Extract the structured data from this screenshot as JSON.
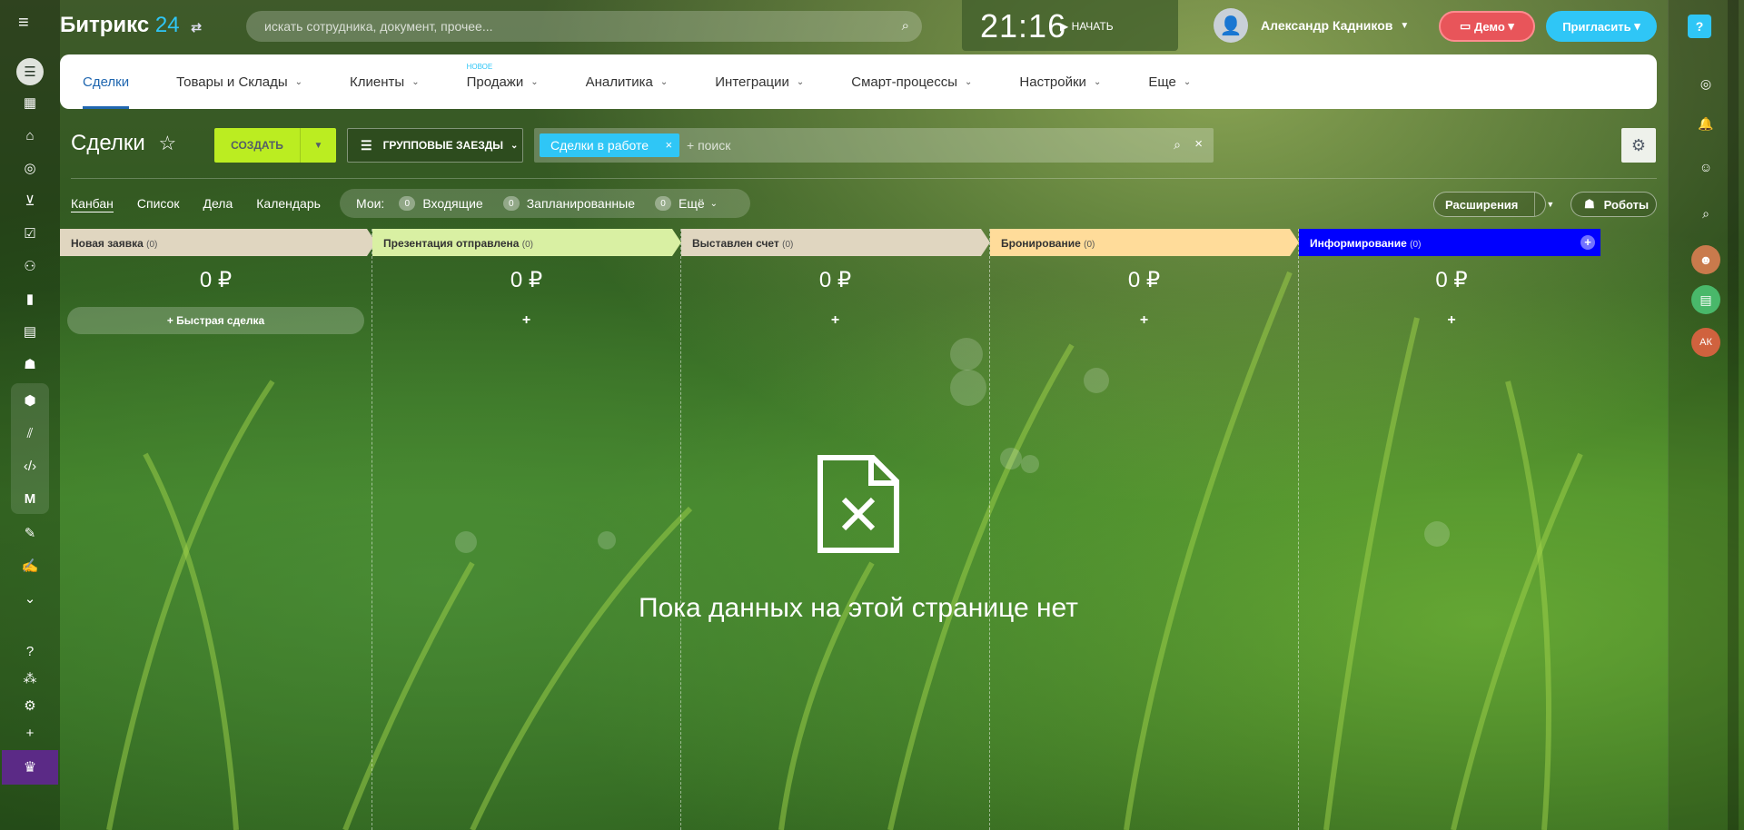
{
  "header": {
    "logo_name": "Битрикс",
    "logo_num": "24",
    "search_placeholder": "искать сотрудника, документ, прочее...",
    "clock_time": "21:16",
    "clock_start": "НАЧАТЬ",
    "user_name": "Александр Кадников",
    "demo_label": "Демо",
    "invite_label": "Пригласить",
    "help_label": "?"
  },
  "nav": {
    "items": [
      {
        "label": "Сделки",
        "active": true
      },
      {
        "label": "Товары и Склады"
      },
      {
        "label": "Клиенты"
      },
      {
        "label": "Продажи",
        "badge": "новое"
      },
      {
        "label": "Аналитика"
      },
      {
        "label": "Интеграции"
      },
      {
        "label": "Смарт-процессы"
      },
      {
        "label": "Настройки"
      },
      {
        "label": "Еще"
      }
    ]
  },
  "toolbar": {
    "title": "Сделки",
    "create_label": "СОЗДАТЬ",
    "group_label": "ГРУППОВЫЕ ЗАЕЗДЫ",
    "filter_tag": "Сделки в работе",
    "filter_placeholder": "+ поиск"
  },
  "views": {
    "items": [
      "Канбан",
      "Список",
      "Дела",
      "Календарь"
    ],
    "mine_label": "Мои:",
    "counters": [
      {
        "count": "0",
        "label": "Входящие"
      },
      {
        "count": "0",
        "label": "Запланированные"
      },
      {
        "count": "0",
        "label": "Ещё"
      }
    ],
    "extensions_label": "Расширения",
    "robots_label": "Роботы"
  },
  "kanban": {
    "columns": [
      {
        "title": "Новая заявка",
        "count": "(0)",
        "sum": "0 ₽",
        "add": "+ Быстрая сделка",
        "color": "#e0d6c0"
      },
      {
        "title": "Презентация отправлена",
        "count": "(0)",
        "sum": "0 ₽",
        "add": "+",
        "color": "#d9f0a3"
      },
      {
        "title": "Выставлен счет",
        "count": "(0)",
        "sum": "0 ₽",
        "add": "+",
        "color": "#e0d6c0"
      },
      {
        "title": "Бронирование",
        "count": "(0)",
        "sum": "0 ₽",
        "add": "+",
        "color": "#ffdc9a"
      },
      {
        "title": "Информирование",
        "count": "(0)",
        "sum": "0 ₽",
        "add": "+",
        "color": "#0000ff"
      }
    ]
  },
  "empty_state": {
    "text": "Пока данных на этой странице нет"
  },
  "right_rail": {
    "avatar_initials": "АК"
  }
}
